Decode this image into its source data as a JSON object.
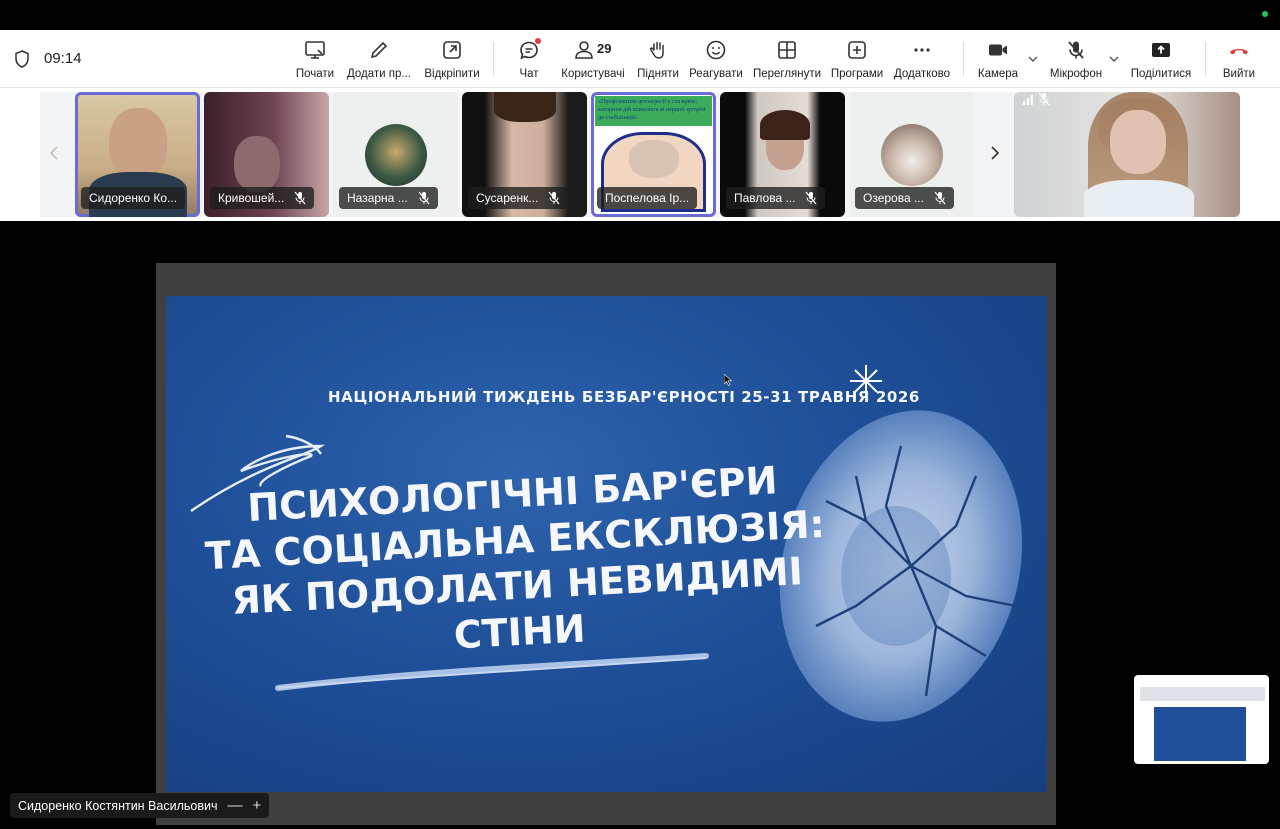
{
  "meeting": {
    "clock": "09:14"
  },
  "toolbar": {
    "start": "Почати",
    "add": "Додати пр...",
    "unpin": "Відкріпити",
    "chat": "Чат",
    "users": "Користувачі",
    "users_count": "29",
    "raise": "Підняти",
    "react": "Реагувати",
    "view": "Переглянути",
    "apps": "Програми",
    "more": "Додатково",
    "camera": "Камера",
    "mic": "Мікрофон",
    "share": "Поділитися",
    "leave": "Вийти"
  },
  "participants": [
    {
      "name": "Сидоренко Ко...",
      "muted": false
    },
    {
      "name": "Кривошей...",
      "muted": true
    },
    {
      "name": "Назарна ...",
      "muted": true
    },
    {
      "name": "Сусаренк...",
      "muted": true
    },
    {
      "name": "Поспелова Ір...",
      "muted": false,
      "slide_text": "«Профілактика аутоагресії у ста криза: алгоритм дій психолога ві першої зустрічі до стабілізації»"
    },
    {
      "name": "Павлова ...",
      "muted": true
    },
    {
      "name": "Озерова ...",
      "muted": true
    }
  ],
  "slide": {
    "subtitle": "НАЦІОНАЛЬНИЙ ТИЖДЕНЬ БЕЗБАР'ЄРНОСТІ 25-31 ТРАВНЯ 2026",
    "title_lines": [
      "ПСИХОЛОГІЧНІ БАР'ЄРИ",
      "ТА СОЦІАЛЬНА ЕКСКЛЮЗІЯ:",
      "ЯК ПОДОЛАТИ НЕВИДИМІ",
      "СТІНИ"
    ]
  },
  "presenter": {
    "name": "Сидоренко Костянтин Васильович",
    "minus": "—",
    "plus": "+"
  },
  "colors": {
    "slide_blue": "#1e4f98",
    "active_outline": "#6b6bd6",
    "leave_red": "#e53935"
  },
  "icons": {
    "start": "screen-share-icon",
    "add": "pencil-icon",
    "unpin": "pop-out-icon",
    "chat": "chat-bubble-icon",
    "users": "person-icon",
    "raise": "hand-icon",
    "react": "smiley-icon",
    "view": "grid-icon",
    "apps": "plus-square-icon",
    "more": "ellipsis-icon",
    "camera": "video-camera-icon",
    "mic": "mic-off-icon",
    "share": "upload-arrow-icon",
    "leave": "phone-hangup-icon"
  }
}
